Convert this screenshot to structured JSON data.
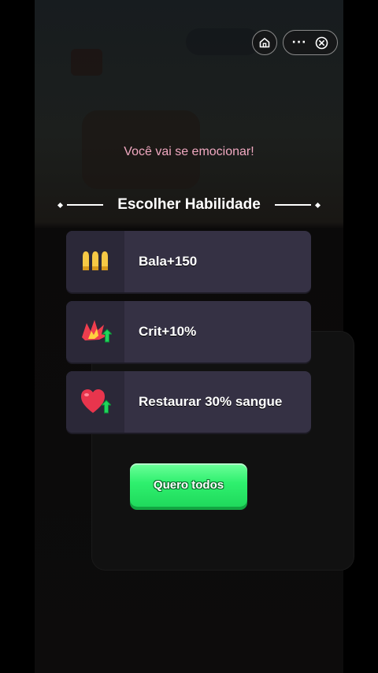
{
  "header": {
    "home_icon": "home-icon",
    "more_icon": "more-dots-icon",
    "more_label": "···",
    "close_icon": "close-circle-icon"
  },
  "banner": {
    "text": "Você vai se emocionar!"
  },
  "dialog": {
    "title": "Escolher Habilidade",
    "skills": [
      {
        "label": "Bala+150",
        "icon": "bullets-icon"
      },
      {
        "label": "Crit+10%",
        "icon": "crit-burst-icon"
      },
      {
        "label": "Restaurar 30% sangue",
        "icon": "heart-plus-icon"
      }
    ],
    "all_button_label": "Quero todos"
  },
  "colors": {
    "banner_text": "#f0a8c0",
    "card_bg": "#353144",
    "card_icon_bg": "#2b2838",
    "button_green": "#2ef06e"
  }
}
